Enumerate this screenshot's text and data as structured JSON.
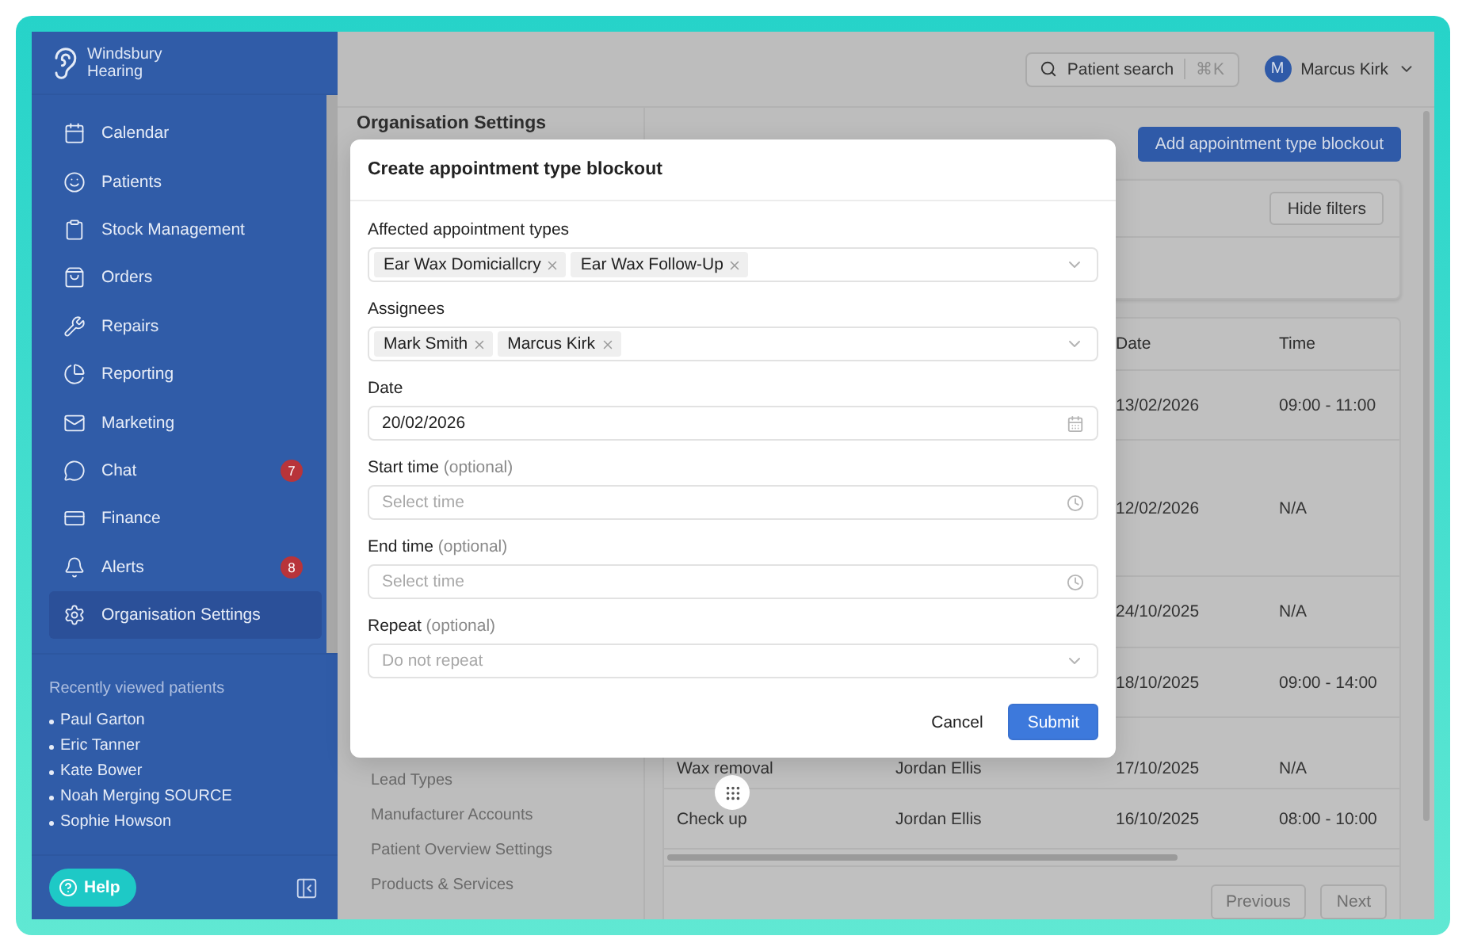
{
  "brand": {
    "lines": [
      "Windsbury",
      "Hearing"
    ]
  },
  "sidebar": {
    "items": [
      {
        "label": "Calendar",
        "selected": false
      },
      {
        "label": "Patients",
        "selected": false
      },
      {
        "label": "Stock Management",
        "selected": false
      },
      {
        "label": "Orders",
        "selected": false
      },
      {
        "label": "Repairs",
        "selected": false
      },
      {
        "label": "Reporting",
        "selected": false
      },
      {
        "label": "Marketing",
        "selected": false
      },
      {
        "label": "Chat",
        "selected": false,
        "badge": "7"
      },
      {
        "label": "Finance",
        "selected": false
      },
      {
        "label": "Alerts",
        "selected": false,
        "badge": "8"
      },
      {
        "label": "Organisation Settings",
        "selected": true
      }
    ],
    "recent": {
      "title": "Recently viewed patients",
      "patients": [
        "Paul Garton",
        "Eric Tanner",
        "Kate Bower",
        "Noah Merging SOURCE",
        "Sophie Howson"
      ]
    },
    "help": "Help"
  },
  "topbar": {
    "search": {
      "label": "Patient search",
      "shortcut": "⌘K"
    },
    "user": {
      "initial": "M",
      "name": "Marcus Kirk"
    }
  },
  "settings_nav": {
    "title": "Organisation Settings",
    "items": [
      "Lead Types",
      "Manufacturer Accounts",
      "Patient Overview Settings",
      "Products & Services"
    ]
  },
  "page": {
    "add_button": "Add appointment type blockout",
    "hide_filters": "Hide filters",
    "table": {
      "columns": [
        "Date",
        "Time"
      ],
      "rows": [
        {
          "date": "13/02/2026",
          "time": "09:00 - 11:00"
        },
        {
          "date": "12/02/2026",
          "time": "N/A"
        },
        {
          "date": "24/10/2025",
          "time": "N/A"
        },
        {
          "date": "18/10/2025",
          "time": "09:00 - 14:00"
        },
        {
          "column_1": "Wax removal",
          "column_2": "Jordan Ellis",
          "date": "17/10/2025",
          "time": "N/A"
        },
        {
          "column_1": "Check up",
          "column_2": "Jordan Ellis",
          "date": "16/10/2025",
          "time": "08:00 - 10:00"
        }
      ]
    },
    "pagination": [
      {
        "label": "Previous",
        "disabled": true
      },
      {
        "label": "Next",
        "disabled": true
      }
    ]
  },
  "modal": {
    "title": "Create appointment type blockout",
    "fields": [
      {
        "kind": "multiselect",
        "label": "Affected appointment types",
        "tags": [
          "Ear Wax Domiciallcry",
          "Ear Wax Follow-Up"
        ]
      },
      {
        "kind": "multiselect",
        "label": "Assignees",
        "tags": [
          "Mark Smith",
          "Marcus Kirk"
        ]
      },
      {
        "kind": "date",
        "label": "Date",
        "value": "20/02/2026"
      },
      {
        "kind": "time",
        "label": "Start time",
        "optional": "(optional)",
        "placeholder": "Select time"
      },
      {
        "kind": "time",
        "label": "End time",
        "optional": "(optional)",
        "placeholder": "Select time"
      },
      {
        "kind": "select",
        "label": "Repeat",
        "optional": "(optional)",
        "placeholder": "Do not repeat"
      }
    ],
    "buttons": [
      {
        "kind": "secondary",
        "label": "Cancel"
      },
      {
        "kind": "primary",
        "label": "Submit"
      }
    ]
  }
}
